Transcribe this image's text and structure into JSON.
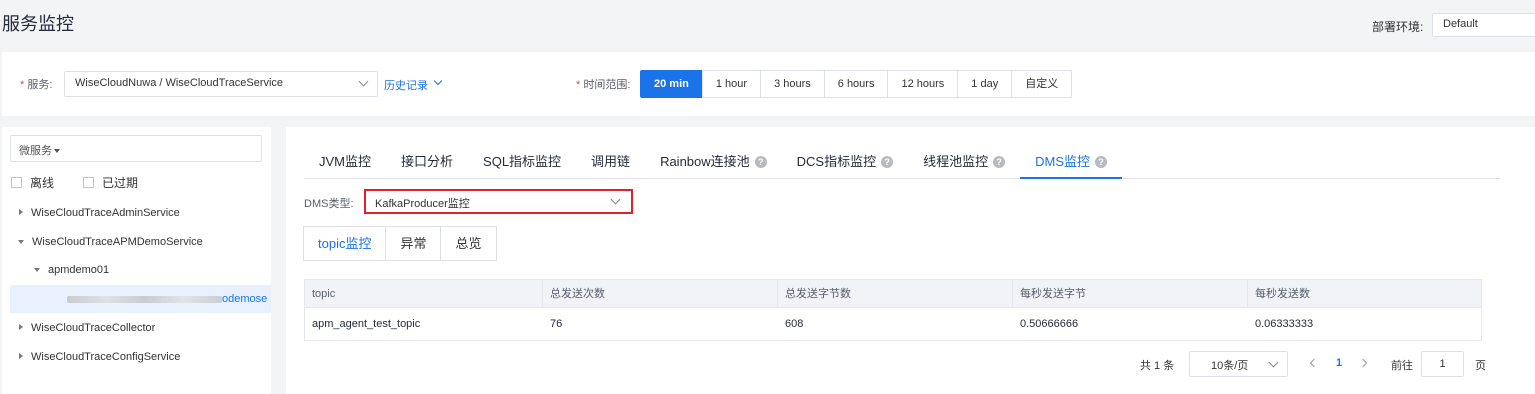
{
  "page": {
    "title": "服务监控"
  },
  "env": {
    "label": "部署环境:",
    "value": "Default"
  },
  "filters": {
    "service_label": "服务:",
    "service_value": "WiseCloudNuwa / WiseCloudTraceService",
    "history_link": "历史记录",
    "time_label": "时间范围:",
    "time_options": [
      "20 min",
      "1 hour",
      "3 hours",
      "6 hours",
      "12 hours",
      "1 day",
      "自定义"
    ],
    "time_active": "20 min"
  },
  "sidebar": {
    "microservice_select": "微服务",
    "checkbox_offline": "离线",
    "checkbox_expired": "已过期",
    "tree": [
      {
        "label": "WiseCloudTraceAdminService",
        "expanded": false
      },
      {
        "label": "WiseCloudTraceAPMDemoService",
        "expanded": true
      },
      {
        "label": "apmdemo01",
        "expanded": true
      },
      {
        "label": "odemose",
        "selected": true
      },
      {
        "label": "WiseCloudTraceCollector",
        "expanded": false
      },
      {
        "label": "WiseCloudTraceConfigService",
        "expanded": false
      }
    ]
  },
  "tabs": [
    {
      "label": "JVM监控",
      "help": false
    },
    {
      "label": "接口分析",
      "help": false
    },
    {
      "label": "SQL指标监控",
      "help": false
    },
    {
      "label": "调用链",
      "help": false
    },
    {
      "label": "Rainbow连接池",
      "help": true
    },
    {
      "label": "DCS指标监控",
      "help": true
    },
    {
      "label": "线程池监控",
      "help": true
    },
    {
      "label": "DMS监控",
      "help": true
    }
  ],
  "help_icon_text": "?",
  "dms": {
    "type_label": "DMS类型:",
    "type_value": "KafkaProducer监控"
  },
  "subtabs": [
    "topic监控",
    "异常",
    "总览"
  ],
  "table": {
    "columns": [
      "topic",
      "总发送次数",
      "总发送字节数",
      "每秒发送字节",
      "每秒发送数"
    ],
    "rows": [
      [
        "apm_agent_test_topic",
        "76",
        "608",
        "0.50666666",
        "0.06333333"
      ]
    ]
  },
  "pagination": {
    "total": "共 1 条",
    "page_size": "10条/页",
    "current_page": "1",
    "goto_label": "前往",
    "goto_value": "1",
    "page_suffix": "页"
  },
  "colors": {
    "accent": "#1a73e8",
    "highlight_border": "#e0202a"
  }
}
